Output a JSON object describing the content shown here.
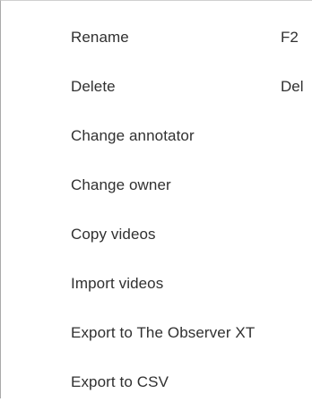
{
  "context_menu": {
    "items": [
      {
        "label": "Rename",
        "shortcut": "F2"
      },
      {
        "label": "Delete",
        "shortcut": "Del"
      },
      {
        "label": "Change annotator"
      },
      {
        "label": "Change owner"
      },
      {
        "label": "Copy videos"
      },
      {
        "label": "Import videos"
      },
      {
        "label": "Export to The Observer XT"
      },
      {
        "label": "Export to CSV"
      }
    ]
  }
}
